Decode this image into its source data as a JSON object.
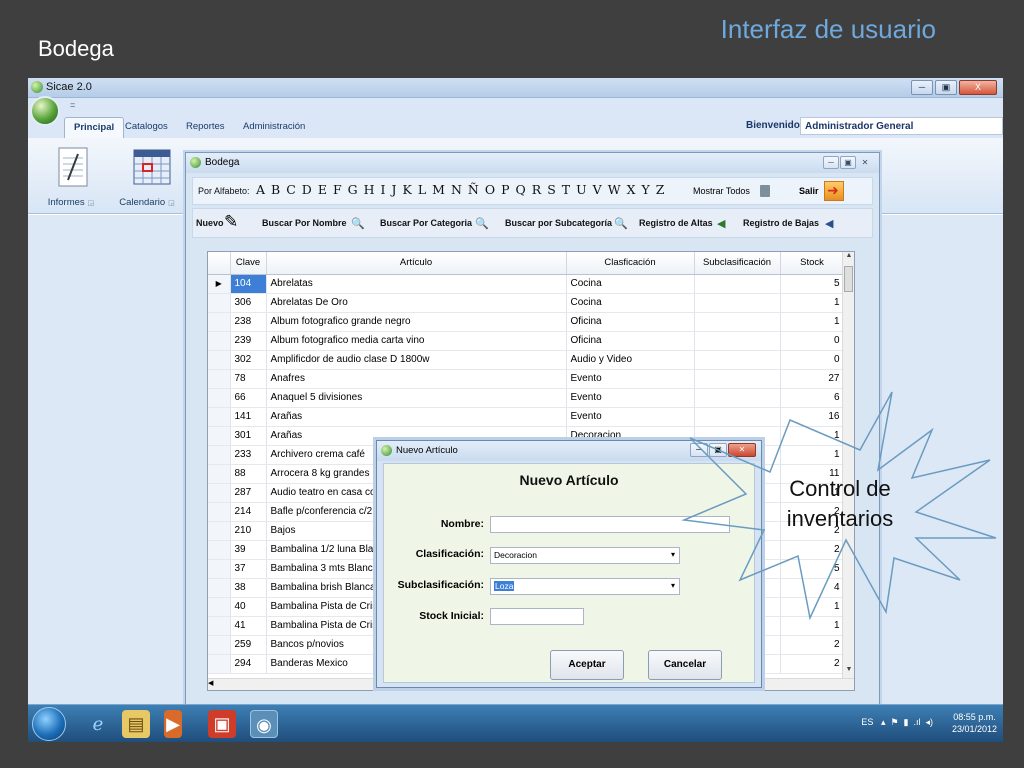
{
  "slide": {
    "title": "Bodega",
    "heading": "Interfaz de usuario"
  },
  "app": {
    "title": "Sicae 2.0",
    "qat": "=",
    "tabs": [
      "Principal",
      "Catalogos",
      "Reportes",
      "Administración"
    ],
    "welcome_label": "Bienvenido",
    "welcome_user": "Administrador General",
    "ribbon_groups": [
      {
        "label": "Informes",
        "icon": "notepad-icon"
      },
      {
        "label": "Calendario",
        "icon": "calendar-icon"
      }
    ],
    "window_controls": [
      "─",
      "▣",
      "X"
    ]
  },
  "bodega": {
    "title": "Bodega",
    "alpha_label": "Por Alfabeto:",
    "letters": [
      "A",
      "B",
      "C",
      "D",
      "E",
      "F",
      "G",
      "H",
      "I",
      "J",
      "K",
      "L",
      "M",
      "N",
      "Ñ",
      "O",
      "P",
      "Q",
      "R",
      "S",
      "T",
      "U",
      "V",
      "W",
      "X",
      "Y",
      "Z"
    ],
    "show_all": "Mostrar Todos",
    "exit": "Salir",
    "toolbar": {
      "nuevo": "Nuevo",
      "buscar_nombre": "Buscar Por Nombre",
      "buscar_categoria": "Buscar Por Categoria",
      "buscar_subcategoria": "Buscar por Subcategoría",
      "registro_altas": "Registro de Altas",
      "registro_bajas": "Registro de Bajas"
    },
    "grid": {
      "columns": [
        "Clave",
        "Artículo",
        "Clasficación",
        "Subclasificación",
        "Stock"
      ],
      "rows": [
        [
          "104",
          "Abrelatas",
          "Cocina",
          "",
          "5"
        ],
        [
          "306",
          "Abrelatas De Oro",
          "Cocina",
          "",
          "1"
        ],
        [
          "238",
          "Album fotografico grande negro",
          "Oficina",
          "",
          "1"
        ],
        [
          "239",
          "Album fotografico media carta vino",
          "Oficina",
          "",
          "0"
        ],
        [
          "302",
          "Amplificdor de audio clase D 1800w",
          "Audio y Video",
          "",
          "0"
        ],
        [
          "78",
          "Anafres",
          "Evento",
          "",
          "27"
        ],
        [
          "66",
          "Anaquel 5 divisiones",
          "Evento",
          "",
          "6"
        ],
        [
          "141",
          "Arañas",
          "Evento",
          "",
          "16"
        ],
        [
          "301",
          "Arañas",
          "Decoracion",
          "",
          "1"
        ],
        [
          "233",
          "Archivero crema  café",
          "Oficina",
          "",
          "1"
        ],
        [
          "88",
          "Arrocera 8 kg grandes",
          "",
          "",
          "11"
        ],
        [
          "287",
          "Audio teatro en casa co",
          "",
          "",
          "1"
        ],
        [
          "214",
          "Bafle p/conferencia c/2 c",
          "",
          "",
          "2"
        ],
        [
          "210",
          "Bajos",
          "",
          "",
          "2"
        ],
        [
          "39",
          "Bambalina 1/2 luna Blan",
          "",
          "",
          "2"
        ],
        [
          "37",
          "Bambalina 3 mts Blanca",
          "",
          "",
          "5"
        ],
        [
          "38",
          "Bambalina brish Blanca",
          "",
          "",
          "4"
        ],
        [
          "40",
          "Bambalina Pista de Cris",
          "",
          "",
          "1"
        ],
        [
          "41",
          "Bambalina Pista de Cris",
          "",
          "",
          "1"
        ],
        [
          "259",
          "Bancos p/novios",
          "",
          "",
          "2"
        ],
        [
          "294",
          "Banderas Mexico",
          "",
          "",
          "2"
        ]
      ]
    }
  },
  "dialog": {
    "title": "Nuevo Artículo",
    "heading": "Nuevo Artículo",
    "fields": {
      "nombre_label": "Nombre:",
      "nombre_value": "",
      "clasificacion_label": "Clasificación:",
      "clasificacion_value": "Decoracion",
      "subclasificacion_label": "Subclasificación:",
      "subclasificacion_value": "Loza",
      "stock_label": "Stock Inicial:",
      "stock_value": ""
    },
    "accept": "Aceptar",
    "cancel": "Cancelar"
  },
  "taskbar": {
    "lang": "ES",
    "time": "08:55 p.m.",
    "date": "23/01/2012"
  },
  "callout": {
    "line1": "Control de",
    "line2": "inventarios"
  }
}
